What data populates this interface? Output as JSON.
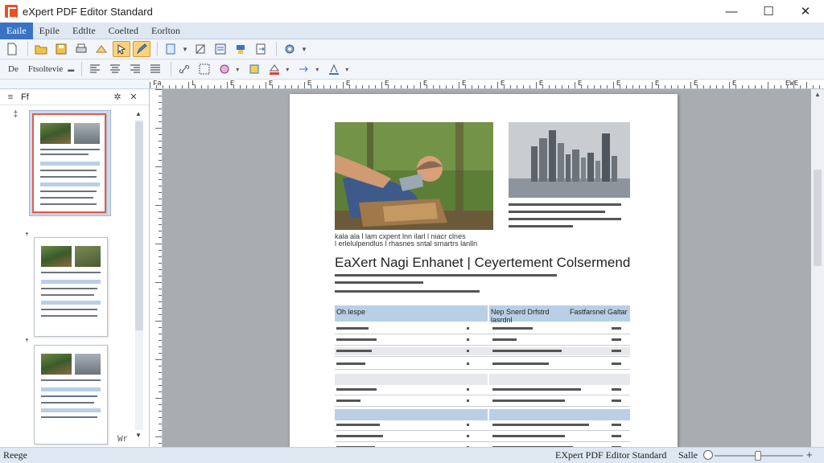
{
  "window": {
    "title": "eXpert PDF Editor Standard",
    "minimize": "—",
    "maximize": "☐",
    "close": "✕"
  },
  "menu": {
    "items": [
      "Eaile",
      "Epile",
      "Edtlte",
      "Coelted",
      "Eorlton"
    ],
    "active_index": 0
  },
  "toolbar1": {
    "icons": [
      "new-document-icon",
      "open-folder-icon",
      "save-icon",
      "print-icon",
      "select-text-icon",
      "hand-tool-icon",
      "edit-tool-icon",
      "page-layout-icon",
      "crop-icon",
      "annotation-icon",
      "stamp-icon",
      "export-icon",
      "settings-icon"
    ]
  },
  "toolbar2": {
    "label_prefix": "De",
    "label_style": "Ftsoltevie",
    "icons": [
      "align-left-icon",
      "align-center-icon",
      "align-right-icon",
      "justify-icon",
      "link-icon",
      "measure-icon",
      "shape-icon",
      "highlight-icon",
      "fill-icon",
      "color-icon",
      "arrow-icon",
      "text-color-icon"
    ]
  },
  "ruler": {
    "labels": [
      "Fa",
      "L",
      "E",
      "E",
      "E",
      "E",
      "E",
      "E",
      "E",
      "E",
      "E",
      "E",
      "E",
      "E",
      "E",
      "E",
      "EWE"
    ]
  },
  "left_panel": {
    "header_icon_left": "≡",
    "header_label": "Ff",
    "header_icon_right": "✕",
    "marks": [
      "‡",
      "ꜛ",
      "ꜛ",
      "Wr"
    ]
  },
  "document": {
    "title": "EaXert Nagi Enhanet | Ceyertement Colsermend",
    "caption": "kala ala l lam cxpent lnn ilarl l niacr clnes",
    "caption2": "l erlelulpendlus l rhasnes sntal srnartrs lanlln",
    "table_headers": [
      "Oh lespe",
      "Nep Snerd Drfstrd lasrdnl",
      "Fastfarsnel Galtar"
    ]
  },
  "status": {
    "left": "Reege",
    "app_name": "EXpert PDF Editor Standard",
    "zoom_label": "Salle",
    "zoom_plus": "+"
  }
}
